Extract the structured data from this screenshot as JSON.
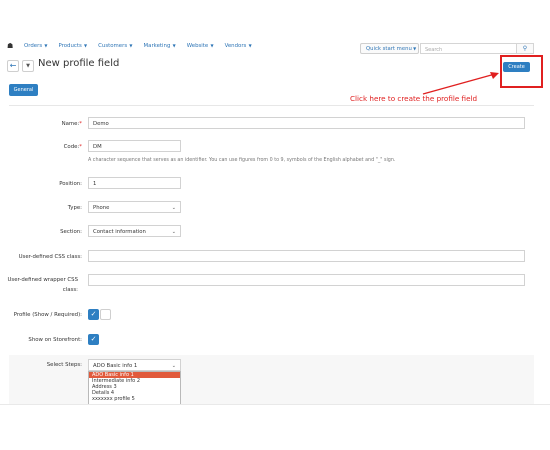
{
  "nav": {
    "home_icon": "home-icon",
    "items": [
      "Orders",
      "Products",
      "Customers",
      "Marketing",
      "Website",
      "Vendors"
    ],
    "quick_start": "Quick start menu",
    "search_placeholder": "Search"
  },
  "header": {
    "title": "New profile field",
    "create_label": "Create"
  },
  "annotation": {
    "text": "Click here to create the profile field",
    "color": "#e02020"
  },
  "tabs": {
    "general": "General"
  },
  "form": {
    "name": {
      "label": "Name:",
      "value": "Demo",
      "required": "*"
    },
    "code": {
      "label": "Code:",
      "value": "DM",
      "required": "*",
      "hint": "A character sequence that serves as an identifier. You can use figures from 0 to 9, symbols of the English alphabet and \"_\" sign."
    },
    "position": {
      "label": "Position:",
      "value": "1"
    },
    "type": {
      "label": "Type:",
      "value": "Phone"
    },
    "section": {
      "label": "Section:",
      "value": "Contact information"
    },
    "css_class": {
      "label": "User-defined CSS class:",
      "value": ""
    },
    "wrapper_css": {
      "label_line1": "User-defined wrapper CSS",
      "label_line2": "class:",
      "value": ""
    },
    "profile_show": {
      "label": "Profile (Show / Required):",
      "show": true,
      "required": false
    },
    "storefront": {
      "label": "Show on Storefront:",
      "checked": true
    },
    "steps": {
      "label": "Select Steps:",
      "selected": "ADO Basic info 1",
      "options": [
        "ADO Basic info 1",
        "Intermediate info 2",
        "Address 3",
        "Details 4",
        "xxxxxxx profile 5"
      ]
    }
  },
  "colors": {
    "accent": "#2e7fc2",
    "link": "#2e75b6",
    "highlight": "#e02020"
  }
}
